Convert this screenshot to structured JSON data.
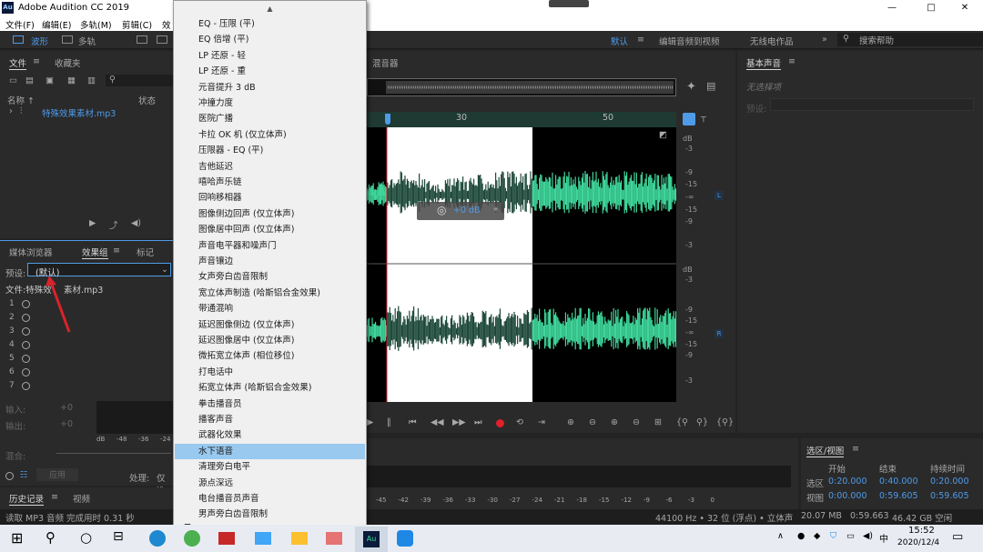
{
  "window": {
    "title": "Adobe Audition CC 2019",
    "logo": "Au",
    "minimize": "—",
    "maximize": "□",
    "close": "✕"
  },
  "menu": [
    "文件(F)",
    "编辑(E)",
    "多轨(M)",
    "剪辑(C)",
    "效"
  ],
  "toolbar": {
    "waveform": "波形",
    "multitrack": "多轨",
    "workspace": "默认",
    "workspace2": "编辑音频到视频",
    "workspace3": "无线电作品",
    "search": "搜索帮助"
  },
  "files_panel": {
    "tab1": "文件",
    "tab2": "收藏夹",
    "col_name": "名称 ↑",
    "col_status": "状态",
    "file": "特殊效果素材.mp3"
  },
  "effects_panel": {
    "tab1": "媒体浏览器",
    "tab2": "效果组",
    "tab3": "标记",
    "preset_label": "预设:",
    "preset_value": "(默认)",
    "file_label": "文件:特殊效",
    "file_label2": "素材.mp3",
    "slots": [
      "1",
      "2",
      "3",
      "4",
      "5",
      "6",
      "7"
    ],
    "input_label": "输入:",
    "input_val": "+0",
    "output_label": "输出:",
    "output_val": "+0",
    "mix_label": "混合:",
    "apply": "应用",
    "process_label": "处理:",
    "process_value": "仅选",
    "db_ticks": [
      "dB",
      "-48",
      "-24"
    ],
    "db_tick_last": "-36"
  },
  "history_panel": {
    "tab1": "历史记录",
    "tab2": "视频"
  },
  "status": {
    "left": "读取 MP3 音频 完成用时 0.31 秒",
    "rate": "44100 Hz • 32 位 (浮点) • 立体声",
    "size": "20.07 MB",
    "duration": "0:59.663",
    "free": "46.42 GB 空闲"
  },
  "editor": {
    "mixer_tab": "混音器",
    "ruler": [
      "30",
      "50"
    ],
    "gain": "+0 dB",
    "ch_L": "L",
    "ch_R": "R",
    "db_top": [
      "dB",
      "-3",
      "-9",
      "-15",
      "-∞",
      "-15",
      "-9",
      "-3"
    ],
    "db_bot": [
      "dB",
      "-3",
      "-9",
      "-15",
      "-∞",
      "-15",
      "-9",
      "-3"
    ],
    "levels": [
      "-45",
      "-42",
      "-39",
      "-36",
      "-33",
      "-30",
      "-27",
      "-24",
      "-21",
      "-18",
      "-15",
      "-12",
      "-9",
      "-6",
      "-3",
      "0"
    ]
  },
  "essential": {
    "title": "基本声音",
    "no_sel": "无选择项",
    "preset": "预设:"
  },
  "selection": {
    "title": "选区/视图",
    "col_start": "开始",
    "col_end": "结束",
    "col_dur": "持续时间",
    "row1": "选区",
    "row2": "视图",
    "r1": [
      "0:20.000",
      "0:40.000",
      "0:20.000"
    ],
    "r2": [
      "0:00.000",
      "0:59.605",
      "0:59.605"
    ]
  },
  "dropdown": {
    "items": [
      "EQ - 压限 (平)",
      "EQ 倍增 (平)",
      "LP 还原 - 轻",
      "LP 还原 - 重",
      "元音提升 3 dB",
      "冲撞力度",
      "医院广播",
      "卡拉 OK 机 (仅立体声)",
      "压限器 - EQ (平)",
      "吉他延迟",
      "嘻哈声乐链",
      "回响移相器",
      "图像侧边回声 (仅立体声)",
      "图像居中回声 (仅立体声)",
      "声音电平器和噪声门",
      "声音镶边",
      "女声旁白齿音限制",
      "宽立体声制造 (哈斯铝合金效果)",
      "带通混响",
      "延迟图像侧边 (仅立体声)",
      "延迟图像居中 (仅立体声)",
      "微拓宽立体声 (相位移位)",
      "打电话中",
      "拓宽立体声 (哈斯铝合金效果)",
      "拳击播音员",
      "播客声音",
      "武器化效果",
      "水下语音",
      "清理旁白电平",
      "源点深远",
      "电台播音员声音",
      "男声旁白齿音限制"
    ],
    "selected_index": 27,
    "scroll_up": "▲",
    "scroll_down": "▼"
  },
  "taskbar": {
    "time": "15:52",
    "date": "2020/12/4",
    "lang": "中"
  }
}
